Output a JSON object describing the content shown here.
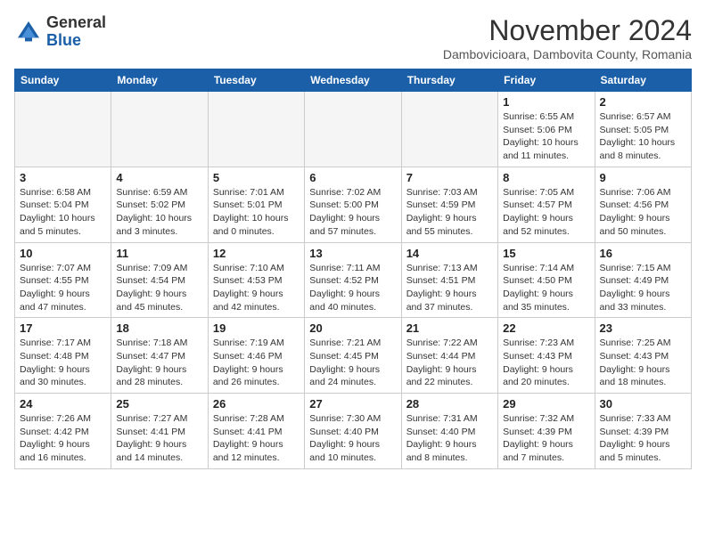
{
  "header": {
    "logo_general": "General",
    "logo_blue": "Blue",
    "month_title": "November 2024",
    "location": "Dambovicioara, Dambovita County, Romania"
  },
  "weekdays": [
    "Sunday",
    "Monday",
    "Tuesday",
    "Wednesday",
    "Thursday",
    "Friday",
    "Saturday"
  ],
  "weeks": [
    [
      {
        "day": "",
        "info": ""
      },
      {
        "day": "",
        "info": ""
      },
      {
        "day": "",
        "info": ""
      },
      {
        "day": "",
        "info": ""
      },
      {
        "day": "",
        "info": ""
      },
      {
        "day": "1",
        "info": "Sunrise: 6:55 AM\nSunset: 5:06 PM\nDaylight: 10 hours and 11 minutes."
      },
      {
        "day": "2",
        "info": "Sunrise: 6:57 AM\nSunset: 5:05 PM\nDaylight: 10 hours and 8 minutes."
      }
    ],
    [
      {
        "day": "3",
        "info": "Sunrise: 6:58 AM\nSunset: 5:04 PM\nDaylight: 10 hours and 5 minutes."
      },
      {
        "day": "4",
        "info": "Sunrise: 6:59 AM\nSunset: 5:02 PM\nDaylight: 10 hours and 3 minutes."
      },
      {
        "day": "5",
        "info": "Sunrise: 7:01 AM\nSunset: 5:01 PM\nDaylight: 10 hours and 0 minutes."
      },
      {
        "day": "6",
        "info": "Sunrise: 7:02 AM\nSunset: 5:00 PM\nDaylight: 9 hours and 57 minutes."
      },
      {
        "day": "7",
        "info": "Sunrise: 7:03 AM\nSunset: 4:59 PM\nDaylight: 9 hours and 55 minutes."
      },
      {
        "day": "8",
        "info": "Sunrise: 7:05 AM\nSunset: 4:57 PM\nDaylight: 9 hours and 52 minutes."
      },
      {
        "day": "9",
        "info": "Sunrise: 7:06 AM\nSunset: 4:56 PM\nDaylight: 9 hours and 50 minutes."
      }
    ],
    [
      {
        "day": "10",
        "info": "Sunrise: 7:07 AM\nSunset: 4:55 PM\nDaylight: 9 hours and 47 minutes."
      },
      {
        "day": "11",
        "info": "Sunrise: 7:09 AM\nSunset: 4:54 PM\nDaylight: 9 hours and 45 minutes."
      },
      {
        "day": "12",
        "info": "Sunrise: 7:10 AM\nSunset: 4:53 PM\nDaylight: 9 hours and 42 minutes."
      },
      {
        "day": "13",
        "info": "Sunrise: 7:11 AM\nSunset: 4:52 PM\nDaylight: 9 hours and 40 minutes."
      },
      {
        "day": "14",
        "info": "Sunrise: 7:13 AM\nSunset: 4:51 PM\nDaylight: 9 hours and 37 minutes."
      },
      {
        "day": "15",
        "info": "Sunrise: 7:14 AM\nSunset: 4:50 PM\nDaylight: 9 hours and 35 minutes."
      },
      {
        "day": "16",
        "info": "Sunrise: 7:15 AM\nSunset: 4:49 PM\nDaylight: 9 hours and 33 minutes."
      }
    ],
    [
      {
        "day": "17",
        "info": "Sunrise: 7:17 AM\nSunset: 4:48 PM\nDaylight: 9 hours and 30 minutes."
      },
      {
        "day": "18",
        "info": "Sunrise: 7:18 AM\nSunset: 4:47 PM\nDaylight: 9 hours and 28 minutes."
      },
      {
        "day": "19",
        "info": "Sunrise: 7:19 AM\nSunset: 4:46 PM\nDaylight: 9 hours and 26 minutes."
      },
      {
        "day": "20",
        "info": "Sunrise: 7:21 AM\nSunset: 4:45 PM\nDaylight: 9 hours and 24 minutes."
      },
      {
        "day": "21",
        "info": "Sunrise: 7:22 AM\nSunset: 4:44 PM\nDaylight: 9 hours and 22 minutes."
      },
      {
        "day": "22",
        "info": "Sunrise: 7:23 AM\nSunset: 4:43 PM\nDaylight: 9 hours and 20 minutes."
      },
      {
        "day": "23",
        "info": "Sunrise: 7:25 AM\nSunset: 4:43 PM\nDaylight: 9 hours and 18 minutes."
      }
    ],
    [
      {
        "day": "24",
        "info": "Sunrise: 7:26 AM\nSunset: 4:42 PM\nDaylight: 9 hours and 16 minutes."
      },
      {
        "day": "25",
        "info": "Sunrise: 7:27 AM\nSunset: 4:41 PM\nDaylight: 9 hours and 14 minutes."
      },
      {
        "day": "26",
        "info": "Sunrise: 7:28 AM\nSunset: 4:41 PM\nDaylight: 9 hours and 12 minutes."
      },
      {
        "day": "27",
        "info": "Sunrise: 7:30 AM\nSunset: 4:40 PM\nDaylight: 9 hours and 10 minutes."
      },
      {
        "day": "28",
        "info": "Sunrise: 7:31 AM\nSunset: 4:40 PM\nDaylight: 9 hours and 8 minutes."
      },
      {
        "day": "29",
        "info": "Sunrise: 7:32 AM\nSunset: 4:39 PM\nDaylight: 9 hours and 7 minutes."
      },
      {
        "day": "30",
        "info": "Sunrise: 7:33 AM\nSunset: 4:39 PM\nDaylight: 9 hours and 5 minutes."
      }
    ]
  ]
}
